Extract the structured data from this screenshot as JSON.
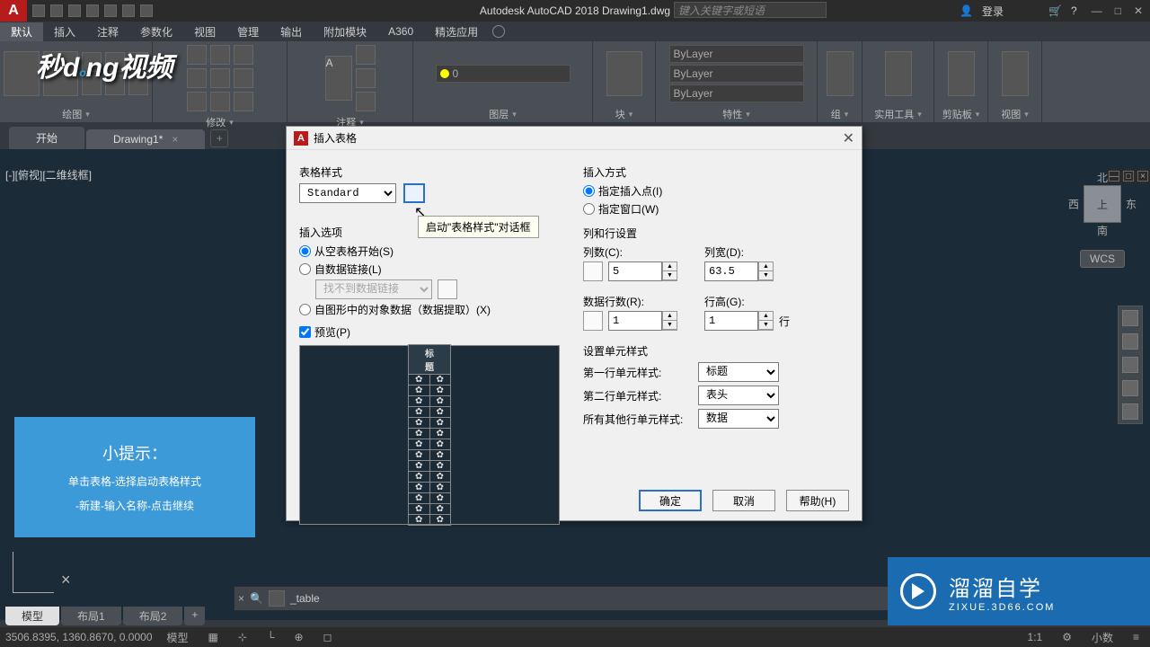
{
  "titlebar": {
    "title": "Autodesk AutoCAD 2018   Drawing1.dwg",
    "search_placeholder": "键入关键字或短语",
    "login": "登录"
  },
  "menu": {
    "items": [
      "默认",
      "插入",
      "注释",
      "参数化",
      "视图",
      "管理",
      "输出",
      "附加模块",
      "A360",
      "精选应用"
    ]
  },
  "ribbon": {
    "panels": [
      "绘图",
      "修改",
      "注释",
      "图层",
      "块",
      "特性",
      "组",
      "实用工具",
      "剪贴板",
      "视图"
    ],
    "bylayer": "ByLayer"
  },
  "tabs": {
    "start": "开始",
    "drawing": "Drawing1*"
  },
  "viewport": {
    "label": "[-][俯视][二维线框]"
  },
  "viewcube": {
    "top": "上",
    "n": "北",
    "s": "南",
    "e": "东",
    "w": "西",
    "wcs": "WCS"
  },
  "hint": {
    "title": "小提示：",
    "line1": "单击表格-选择启动表格样式",
    "line2": "-新建-输入名称-点击继续"
  },
  "cmd": {
    "text": "_table",
    "x": "×"
  },
  "layout": {
    "model": "模型",
    "l1": "布局1",
    "l2": "布局2"
  },
  "status": {
    "coords": "3506.8395, 1360.8670, 0.0000",
    "model": "模型",
    "scale": "1:1",
    "dec": "小数"
  },
  "dialog": {
    "title": "插入表格",
    "style_group": "表格样式",
    "style_value": "Standard",
    "tooltip": "启动\"表格样式\"对话框",
    "insert_opts": "插入选项",
    "opt_empty": "从空表格开始(S)",
    "opt_link": "自数据链接(L)",
    "opt_link_combo": "找不到数据链接",
    "opt_extract": "自图形中的对象数据（数据提取）(X)",
    "preview": "预览(P)",
    "preview_header": "标题",
    "insert_method": "插入方式",
    "method_point": "指定插入点(I)",
    "method_window": "指定窗口(W)",
    "rowcol": "列和行设置",
    "cols": "列数(C):",
    "cols_v": "5",
    "colw": "列宽(D):",
    "colw_v": "63.5",
    "rows": "数据行数(R):",
    "rows_v": "1",
    "rowh": "行高(G):",
    "rowh_v": "1",
    "rowh_unit": "行",
    "cellstyle": "设置单元样式",
    "first": "第一行单元样式:",
    "first_v": "标题",
    "second": "第二行单元样式:",
    "second_v": "表头",
    "other": "所有其他行单元样式:",
    "other_v": "数据",
    "ok": "确定",
    "cancel": "取消",
    "help": "帮助(H)"
  },
  "brand": {
    "name": "溜溜自学",
    "url": "ZIXUE.3D66.COM"
  }
}
